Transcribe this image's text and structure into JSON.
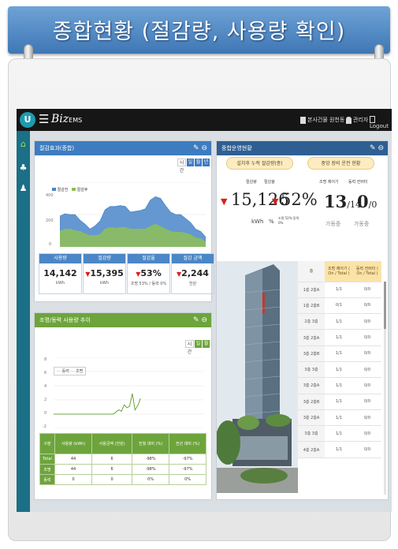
{
  "banner": {
    "title": "종합현황 (절감량, 사용량 확인)"
  },
  "topbar": {
    "logo_text": "U",
    "brand": "Biz",
    "brand_suffix": "EMS",
    "site": "본사건물 원천동",
    "user": "관리자",
    "logout": "Logout"
  },
  "sidebar": {
    "items": [
      "home-icon",
      "tree-icon",
      "user-icon"
    ]
  },
  "panel_saving": {
    "title": "절감효과(종합)",
    "toggles": [
      "시간",
      "일",
      "월",
      "년"
    ],
    "legend": [
      "절감전",
      "절감후"
    ],
    "yticks": [
      "400",
      "200",
      "0"
    ],
    "chart_data": {
      "type": "area",
      "series": [
        {
          "name": "절감전",
          "color": "#4a86c8",
          "values": [
            190,
            205,
            200,
            200,
            165,
            140,
            110,
            130,
            160,
            230,
            250,
            250,
            255,
            250,
            215,
            220,
            225,
            235,
            290,
            310,
            300,
            255,
            215,
            200,
            200,
            175,
            150,
            110,
            95,
            60
          ]
        },
        {
          "name": "절감후",
          "color": "#8fbf57",
          "values": [
            95,
            110,
            110,
            100,
            95,
            80,
            70,
            70,
            75,
            110,
            120,
            115,
            120,
            120,
            110,
            110,
            110,
            110,
            125,
            140,
            125,
            110,
            95,
            90,
            90,
            85,
            75,
            55,
            50,
            30
          ]
        }
      ],
      "ylim": [
        0,
        400
      ]
    },
    "kpis": [
      {
        "label": "사용량",
        "value": "14,142",
        "unit": "kWh",
        "down": false
      },
      {
        "label": "절감량",
        "value": "15,395",
        "unit": "kWh",
        "down": true
      },
      {
        "label": "절감율",
        "value": "53%",
        "unit": "조명 53% / 동력 0%",
        "down": true
      },
      {
        "label": "절감 금액",
        "value": "2,244",
        "unit": "천원",
        "down": true
      }
    ]
  },
  "panel_usage": {
    "title": "조명/동력 사용량 추이",
    "toggles": [
      "시간",
      "일",
      "월"
    ],
    "legend": [
      "동력",
      "조명"
    ],
    "yticks": [
      "8",
      "6",
      "4",
      "2",
      "0",
      "-2"
    ],
    "chart_data": {
      "type": "line",
      "series": [
        {
          "name": "조명",
          "color": "#6da43c",
          "values": [
            0,
            0,
            0,
            0,
            0,
            0,
            0,
            0,
            0,
            0,
            0,
            0,
            0,
            0,
            0,
            0,
            0,
            0,
            0,
            0,
            0,
            0,
            0,
            0.3,
            0.6,
            0.4,
            1.3,
            0.9,
            1.1,
            2.9,
            0.6,
            1.2,
            2.2
          ]
        }
      ],
      "ylim": [
        -2,
        8
      ]
    },
    "table": {
      "headers": [
        "구분",
        "사용량 (kWh)",
        "사용금액 (천원)",
        "전월 대비 (%)",
        "전년 대비 (%)"
      ],
      "rows": [
        [
          "Total",
          "44",
          "6",
          "-98%",
          "-97%"
        ],
        [
          "조명",
          "44",
          "6",
          "-98%",
          "-97%"
        ],
        [
          "동력",
          "0",
          "0",
          "0%",
          "0%"
        ]
      ]
    }
  },
  "panel_status": {
    "title": "종합운영현황",
    "pill_left": "설치후 누적 절감량(종)",
    "pill_right": "중앙 장비 운전 현황",
    "col_labels": [
      "절감량",
      "절감율"
    ],
    "right_labels": [
      "조명 제어기",
      "동력 컨버터"
    ],
    "big_value": "15,126",
    "big_pct": "52%",
    "unit_kwh": "kWh",
    "unit_pct": "%",
    "pct_note": "조명 52% 동력 0%",
    "ctrl_on": "13",
    "ctrl_total": "14",
    "conv_on": "0",
    "conv_total": "0",
    "run_label": "가동중",
    "eq_headers": [
      "층",
      "조명 제어기 ( On / Total )",
      "동력 컨버터 ( On / Total )"
    ],
    "eq_rows": [
      [
        "1층 2층A",
        "1/1",
        "0/0"
      ],
      [
        "1층 2층B",
        "0/1",
        "0/0"
      ],
      [
        "2층 3층",
        "1/1",
        "0/0"
      ],
      [
        "3층 2층A",
        "1/1",
        "0/0"
      ],
      [
        "3층 2층B",
        "1/1",
        "0/0"
      ],
      [
        "3층 3층",
        "1/1",
        "0/0"
      ],
      [
        "3층 2층A",
        "1/1",
        "0/0"
      ],
      [
        "3층 2층B",
        "1/1",
        "0/0"
      ],
      [
        "3층 2층A",
        "1/1",
        "0/0"
      ],
      [
        "3층 3층",
        "1/1",
        "0/0"
      ],
      [
        "4층 2층A",
        "1/1",
        "0/0"
      ]
    ],
    "eq_alert_row": 1
  }
}
